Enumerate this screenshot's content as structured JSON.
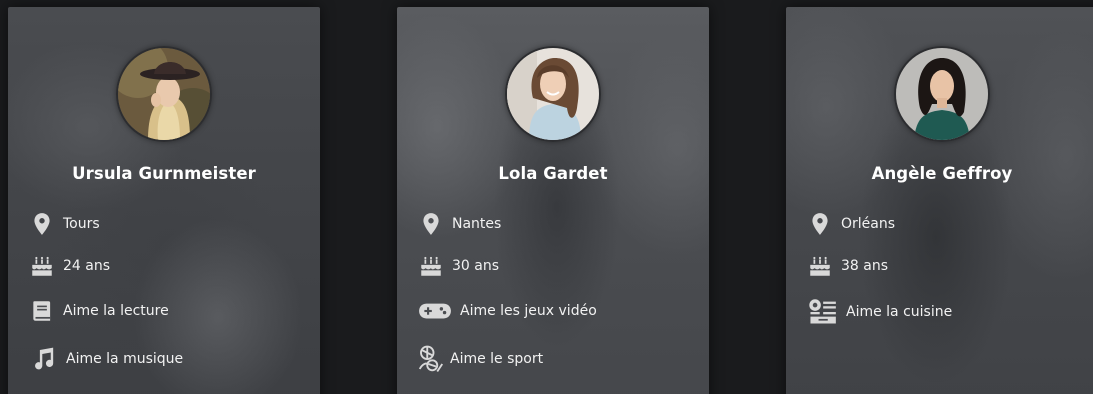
{
  "profiles": [
    {
      "name": "Ursula Gurnmeister",
      "city": "Tours",
      "age": "24 ans",
      "hobbies": [
        {
          "label": "Aime la lecture",
          "icon": "book-icon"
        },
        {
          "label": "Aime la musique",
          "icon": "music-note-icon"
        }
      ]
    },
    {
      "name": "Lola Gardet",
      "city": "Nantes",
      "age": "30 ans",
      "hobbies": [
        {
          "label": "Aime les jeux vidéo",
          "icon": "gamepad-icon"
        },
        {
          "label": "Aime le sport",
          "icon": "sport-icon"
        }
      ]
    },
    {
      "name": "Angèle Geffroy",
      "city": "Orléans",
      "age": "38 ans",
      "hobbies": [
        {
          "label": "Aime la cuisine",
          "icon": "cooking-icon"
        }
      ]
    }
  ],
  "icons": {
    "location": "map-pin-icon",
    "age": "birthday-cake-icon"
  },
  "colors": {
    "page_background": "#1a1b1d",
    "text": "#ffffff",
    "icon": "#d9d9d9"
  }
}
